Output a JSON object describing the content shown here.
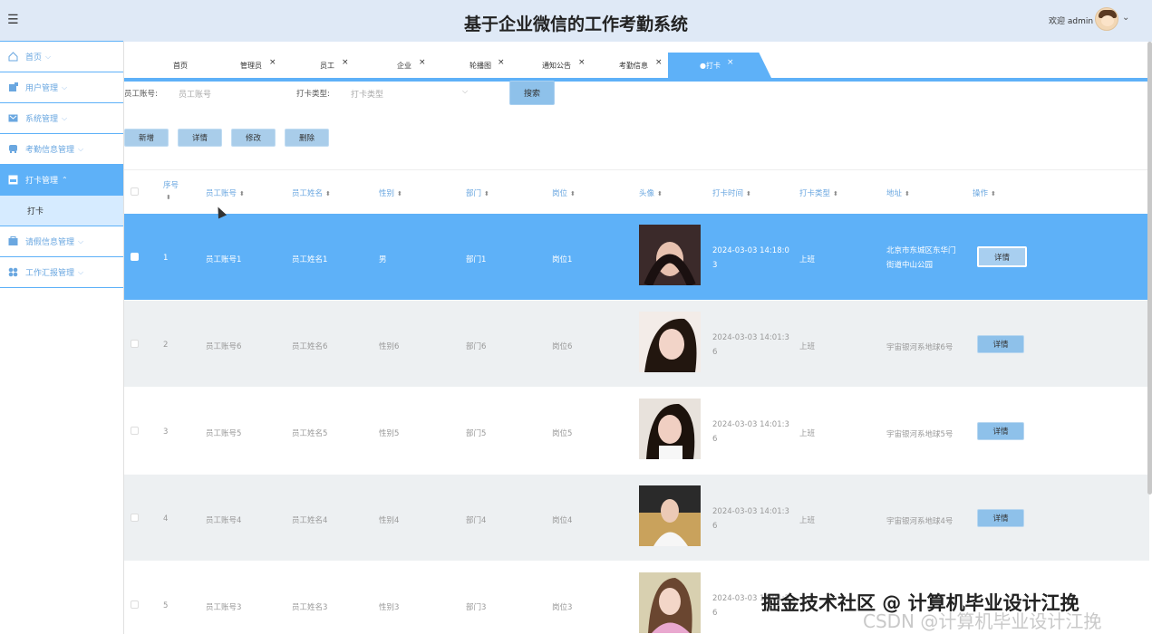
{
  "header": {
    "title": "基于企业微信的工作考勤系统",
    "welcome": "欢迎 admin",
    "menu_icon": "hamburger-icon"
  },
  "sidebar": {
    "items": [
      {
        "label": "首页",
        "icon": "home-icon"
      },
      {
        "label": "用户管理",
        "icon": "user-icon"
      },
      {
        "label": "系统管理",
        "icon": "system-icon"
      },
      {
        "label": "考勤信息管理",
        "icon": "attendance-icon"
      },
      {
        "label": "打卡管理",
        "icon": "clockin-icon",
        "active": true
      },
      {
        "label": "请假信息管理",
        "icon": "leave-icon"
      },
      {
        "label": "工作汇报管理",
        "icon": "report-icon"
      }
    ],
    "sub_item": "打卡"
  },
  "tabs": [
    "首页",
    "管理员",
    "员工",
    "企业",
    "轮播图",
    "通知公告",
    "考勤信息",
    "●打卡"
  ],
  "tab_close": "×",
  "search": {
    "account_label": "员工账号:",
    "account_placeholder": "员工账号",
    "type_label": "打卡类型:",
    "type_placeholder": "打卡类型",
    "button": "搜索"
  },
  "actions": {
    "add": "新增",
    "detail": "详情",
    "edit": "修改",
    "delete": "删除"
  },
  "table": {
    "headers": [
      "序号",
      "员工账号",
      "员工姓名",
      "性别",
      "部门",
      "岗位",
      "头像",
      "打卡时间",
      "打卡类型",
      "地址",
      "操作"
    ],
    "rows": [
      {
        "no": "1",
        "account": "员工账号1",
        "name": "员工姓名1",
        "gender": "男",
        "dept": "部门1",
        "post": "岗位1",
        "time": "2024-03-03 14:18:03",
        "type": "上班",
        "addr": "北京市东城区东华门街道中山公园",
        "op": "详情"
      },
      {
        "no": "2",
        "account": "员工账号6",
        "name": "员工姓名6",
        "gender": "性别6",
        "dept": "部门6",
        "post": "岗位6",
        "time": "2024-03-03 14:01:36",
        "type": "上班",
        "addr": "宇宙银河系地球6号",
        "op": "详情"
      },
      {
        "no": "3",
        "account": "员工账号5",
        "name": "员工姓名5",
        "gender": "性别5",
        "dept": "部门5",
        "post": "岗位5",
        "time": "2024-03-03 14:01:36",
        "type": "上班",
        "addr": "宇宙银河系地球5号",
        "op": "详情"
      },
      {
        "no": "4",
        "account": "员工账号4",
        "name": "员工姓名4",
        "gender": "性别4",
        "dept": "部门4",
        "post": "岗位4",
        "time": "2024-03-03 14:01:36",
        "type": "上班",
        "addr": "宇宙银河系地球4号",
        "op": "详情"
      },
      {
        "no": "5",
        "account": "员工账号3",
        "name": "员工姓名3",
        "gender": "性别3",
        "dept": "部门3",
        "post": "岗位3",
        "time": "2024-03-03 14:01:36",
        "type": "",
        "addr": "",
        "op": ""
      }
    ]
  },
  "watermark": "掘金技术社区 @ 计算机毕业设计江挽",
  "watermark2": "CSDN @计算机毕业设计江挽",
  "colors": {
    "accent": "#5eb1f8",
    "header_bg": "#dfe9f6",
    "button": "#8ec1ea"
  }
}
